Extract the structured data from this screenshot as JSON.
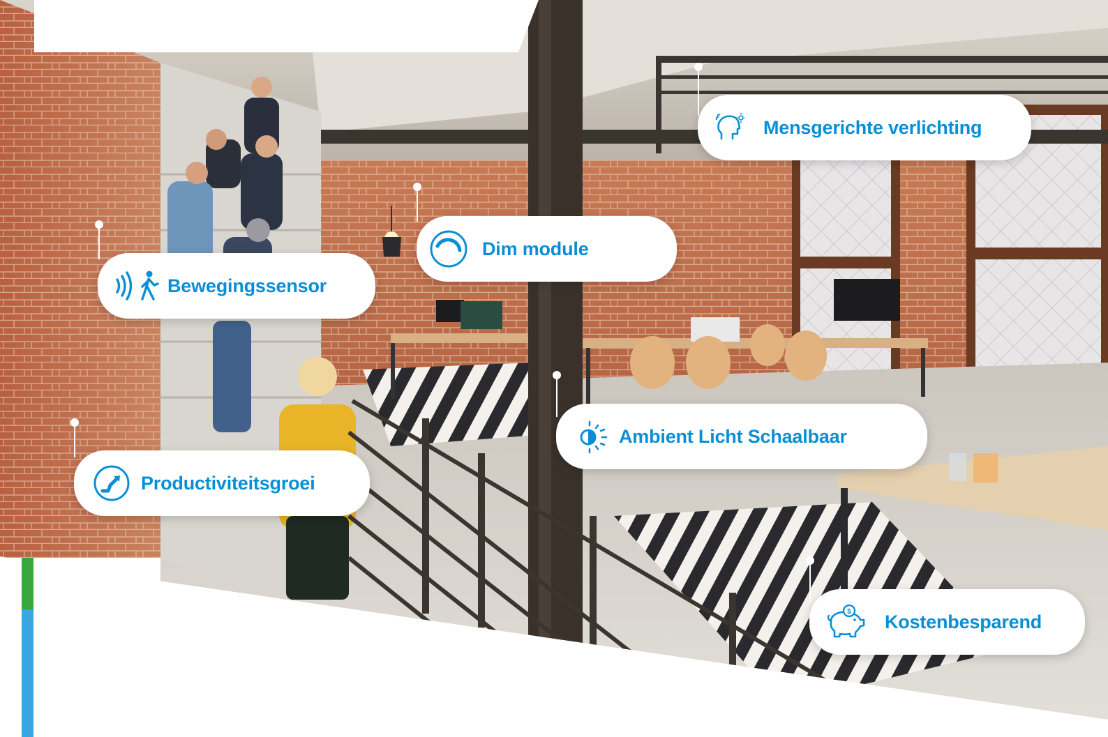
{
  "colors": {
    "accent_blue": "#0a8fd6",
    "strip": [
      "#d71f4a",
      "#e8561f",
      "#7fbf2e",
      "#3aa63f",
      "#3aa6e0"
    ]
  },
  "photo": {
    "scene": "office-loft-photo"
  },
  "callouts": [
    {
      "id": "mensgericht",
      "icon": "human-head-light-icon",
      "label": "Mensgerichte verlichting"
    },
    {
      "id": "dim",
      "icon": "dim-dial-icon",
      "label": "Dim module"
    },
    {
      "id": "beweging",
      "icon": "motion-sensor-icon",
      "label": "Bewegingssensor"
    },
    {
      "id": "ambient",
      "icon": "ambient-light-icon",
      "label": "Ambient Licht Schaalbaar"
    },
    {
      "id": "productiviteit",
      "icon": "growth-arrow-icon",
      "label": "Productiviteitsgroei"
    },
    {
      "id": "kosten",
      "icon": "piggy-bank-icon",
      "label": "Kostenbesparend"
    }
  ]
}
